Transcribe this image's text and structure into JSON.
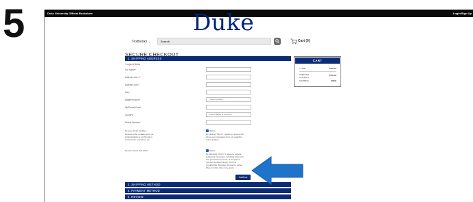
{
  "step_number": "5",
  "topbar": {
    "store_name": "Duke University Official Bookstore",
    "login": "Login/Sign Up"
  },
  "logo": "Duke",
  "nav": {
    "textbooks": "Textbooks",
    "search_placeholder": "Search",
    "cart": "Cart (0)"
  },
  "page_title": "SECURE CHECKOUT",
  "sections": [
    {
      "label": "1. SHIPPING ADDRESS"
    },
    {
      "label": "2. SHIPPING METHOD"
    },
    {
      "label": "3. PAYMENT METHOD"
    },
    {
      "label": "4. REVIEW"
    }
  ],
  "required_note": "* required fields",
  "fields": [
    {
      "label": "Full Name*",
      "value": ""
    },
    {
      "label": "Address Line 1*",
      "value": ""
    },
    {
      "label": "Address Line 2",
      "value": ""
    },
    {
      "label": "City*",
      "value": ""
    },
    {
      "label": "State/Province*",
      "value": "- Select a State -"
    },
    {
      "label": "Zip/Postal Code*",
      "value": ""
    },
    {
      "label": "Country*",
      "value": "United States of America"
    },
    {
      "label": "Phone Number*",
      "value": ""
    }
  ],
  "order_updates": {
    "label": "Receive Order Updates",
    "sublabel": "Receive order updates such as shipping/delivery confirmation, rental return reminders, etc.",
    "checkbox": "Opt-In",
    "desc": "By clicking \"Opt-In\" I agree to receive cell phone text messages from us regarding order updates."
  },
  "news_offers": {
    "label": "Receive News and Offers",
    "checkbox": "Opt-In",
    "desc": "By selecting \"Opt-In\" I agree to receive marketing messages, including discounts and promotional events, at the phone number provided. Reply STOP to unsubscribe. Message frequency varies. Msg and data rates may apply."
  },
  "continue_label": "Continue",
  "cart": {
    "title": "CART",
    "items_label": "1 ITEM",
    "items_amount": "$160.35",
    "subtotal_label": "SUBTOTAL",
    "tax_label": "TAX (EST.)",
    "subtotal_amount": "$160.35",
    "shipping_label": "SHIPPING",
    "shipping_amount": "FREE"
  },
  "colors": {
    "brand_navy": "#0b2c75",
    "duke_blue": "#00247d",
    "arrow_blue": "#1e74c9",
    "optin_blue": "#1f5fbf"
  }
}
